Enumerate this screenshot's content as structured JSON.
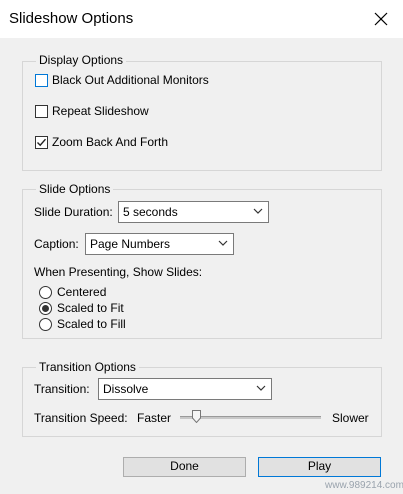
{
  "window": {
    "title": "Slideshow Options",
    "close_icon": "close-icon"
  },
  "display": {
    "legend": "Display Options",
    "black_out": {
      "label": "Black Out Additional Monitors",
      "checked": false
    },
    "repeat": {
      "label": "Repeat Slideshow",
      "checked": false
    },
    "zoom": {
      "label": "Zoom Back And Forth",
      "checked": true
    }
  },
  "slide": {
    "legend": "Slide Options",
    "duration_label": "Slide Duration:",
    "duration_value": "5 seconds",
    "caption_label": "Caption:",
    "caption_value": "Page Numbers",
    "presenting_label": "When Presenting, Show Slides:",
    "options": [
      {
        "label": "Centered",
        "selected": false
      },
      {
        "label": "Scaled to Fit",
        "selected": true
      },
      {
        "label": "Scaled to Fill",
        "selected": false
      }
    ]
  },
  "transition": {
    "legend": "Transition Options",
    "transition_label": "Transition:",
    "transition_value": "Dissolve",
    "speed_label": "Transition Speed:",
    "faster": "Faster",
    "slower": "Slower",
    "speed_level": 0.12
  },
  "buttons": {
    "done": "Done",
    "play": "Play"
  },
  "watermark": "www.989214.com",
  "colors": {
    "focus": "#0078d7",
    "background": "#f0f0f0"
  }
}
